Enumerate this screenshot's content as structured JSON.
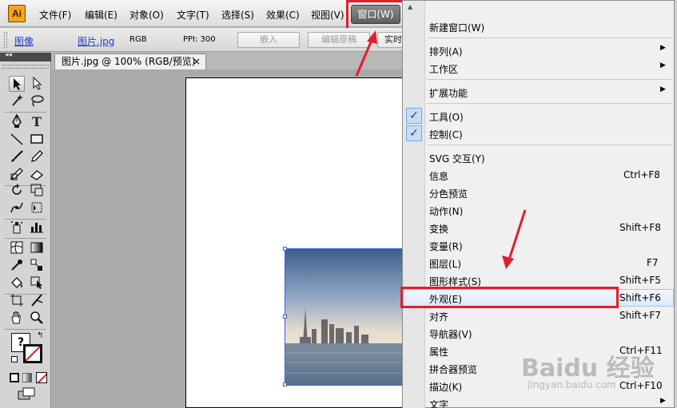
{
  "app": {
    "logo": "Ai"
  },
  "menubar": {
    "items": [
      "文件(F)",
      "编辑(E)",
      "对象(O)",
      "文字(T)",
      "选择(S)",
      "效果(C)",
      "视图(V)"
    ],
    "active": "窗口(W)"
  },
  "controlbar": {
    "link_image": "图像",
    "link_file": "图片.jpg",
    "color_mode": "RGB",
    "ppi": "PPI: 300",
    "embed_btn": "嵌入",
    "edit_original_btn": "编辑原稿",
    "partial_btn": "实时"
  },
  "document": {
    "tab_title": "图片.jpg @ 100% (RGB/预览)",
    "tab_close": "×"
  },
  "tools": {
    "type_icon": "T",
    "unknown_fill": "?",
    "icons": [
      "selection-arrow",
      "direct-selection",
      "magic-wand",
      "lasso",
      "pen",
      "type",
      "line",
      "rectangle",
      "paintbrush",
      "pencil",
      "blob-brush",
      "eraser",
      "rotate",
      "scale",
      "warp",
      "free-transform",
      "symbol-sprayer",
      "column-graph",
      "mesh",
      "gradient",
      "eyedropper",
      "blend",
      "live-paint-bucket",
      "live-paint-selection",
      "artboard",
      "slice",
      "hand",
      "zoom"
    ]
  },
  "window_menu": {
    "items": [
      {
        "label": "新建窗口(W)",
        "shortcut": ""
      },
      {
        "label": "排列(A)",
        "submenu": true
      },
      {
        "label": "工作区",
        "submenu": true
      },
      {
        "label": "扩展功能",
        "submenu": true
      },
      {
        "label": "工具(O)",
        "checked": true
      },
      {
        "label": "控制(C)",
        "checked": true
      },
      {
        "label": "SVG 交互(Y)",
        "shortcut": ""
      },
      {
        "label": "信息",
        "shortcut": "Ctrl+F8"
      },
      {
        "label": "分色预览",
        "shortcut": ""
      },
      {
        "label": "动作(N)",
        "shortcut": ""
      },
      {
        "label": "变换",
        "shortcut": "Shift+F8"
      },
      {
        "label": "变量(R)",
        "shortcut": ""
      },
      {
        "label": "图层(L)",
        "shortcut": "F7"
      },
      {
        "label": "图形样式(S)",
        "shortcut": "Shift+F5"
      },
      {
        "label": "外观(E)",
        "shortcut": "Shift+F6",
        "highlighted": true
      },
      {
        "label": "对齐",
        "shortcut": "Shift+F7"
      },
      {
        "label": "导航器(V)",
        "shortcut": ""
      },
      {
        "label": "属性",
        "shortcut": "Ctrl+F11"
      },
      {
        "label": "拼合器预览",
        "shortcut": ""
      },
      {
        "label": "描边(K)",
        "shortcut": "Ctrl+F10"
      },
      {
        "label": "文字",
        "submenu": true
      }
    ],
    "check_glyph": "✓",
    "submenu_arrow": "▶",
    "scroll_arrow": "▲"
  },
  "watermark": {
    "brand": "Baidu 经验",
    "url": "jingyan.baidu.com"
  },
  "colors": {
    "annotation": "#e21e2b",
    "highlight_border": "#a9c4ec",
    "link": "#1a3fd1"
  }
}
